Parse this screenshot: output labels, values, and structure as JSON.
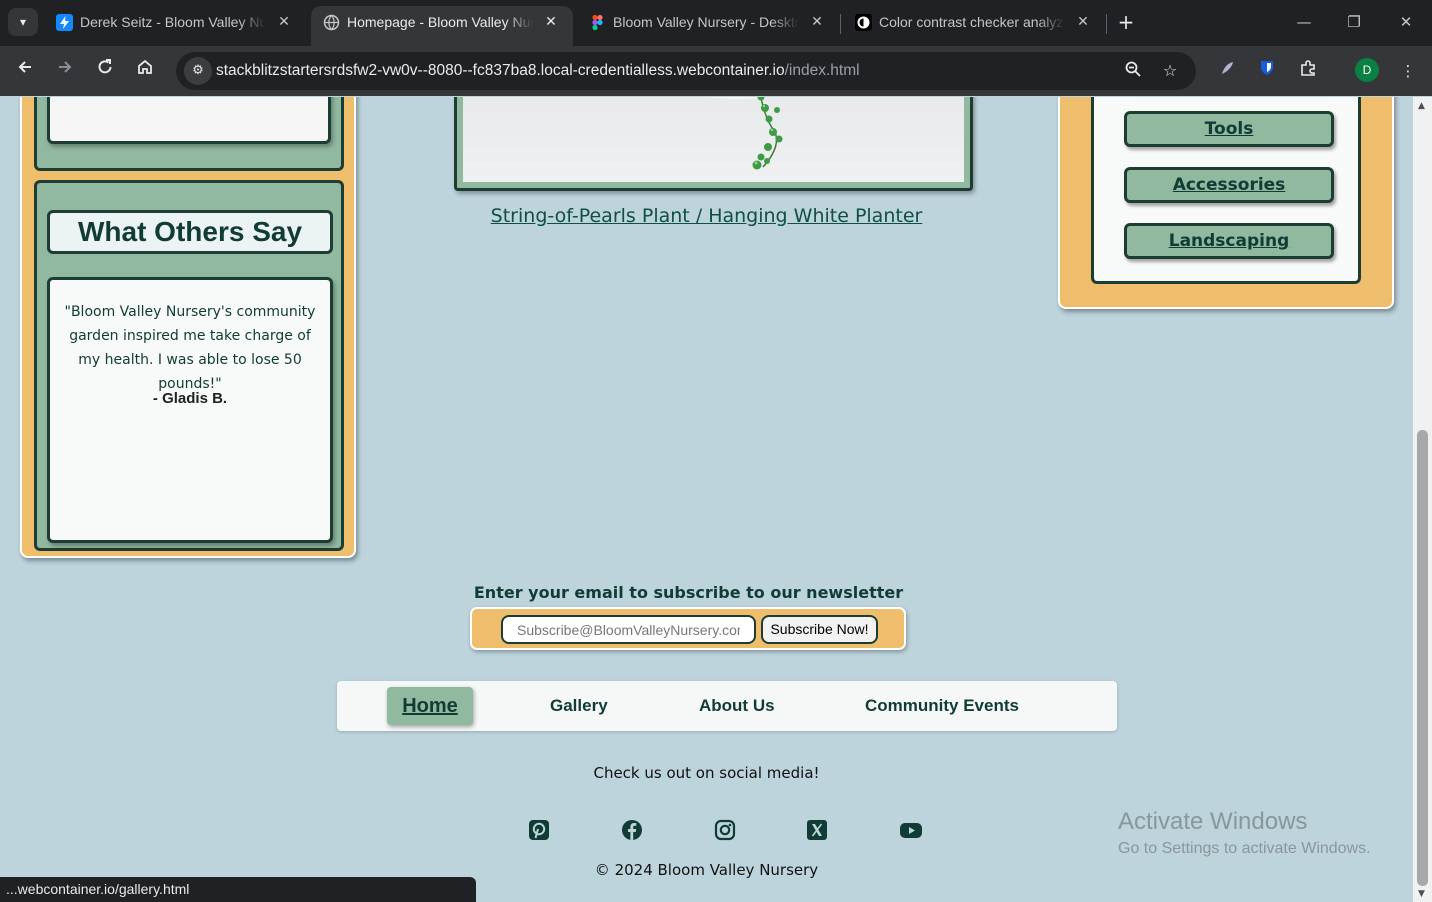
{
  "browser": {
    "tabs": [
      {
        "title": "Derek Seitz - Bloom Valley Nurs",
        "active": false,
        "favicon": "stackblitz-icon"
      },
      {
        "title": "Homepage - Bloom Valley Nurs",
        "active": true,
        "favicon": "globe-icon"
      },
      {
        "title": "Bloom Valley Nursery - Desktop",
        "active": false,
        "favicon": "figma-icon"
      },
      {
        "title": "Color contrast checker analyzer",
        "active": false,
        "favicon": "contrast-icon"
      }
    ],
    "url_main": "stackblitzstartersrdsfw2-vw0v--8080--fc837ba8.local-credentialless.webcontainer.io",
    "url_path": "/index.html",
    "profile_initial": "D",
    "status_url": "...webcontainer.io/gallery.html"
  },
  "testimonial": {
    "heading": "What Others Say",
    "quote": "\"Bloom Valley Nursery's community garden inspired me take charge of my health. I was able to lose 50 pounds!\"",
    "author": "- Gladis B."
  },
  "product": {
    "link": "String-of-Pearls Plant / Hanging White Planter"
  },
  "categories": {
    "items": [
      "Tools",
      "Accessories",
      "Landscaping"
    ]
  },
  "newsletter": {
    "label": "Enter your email to subscribe to our newsletter",
    "placeholder": "Subscribe@BloomValleyNursery.com",
    "button": "Subscribe Now!"
  },
  "footer_nav": {
    "home": "Home",
    "gallery": "Gallery",
    "about": "About Us",
    "events": "Community Events"
  },
  "social": {
    "label": "Check us out on social media!",
    "icons": [
      "pinterest-icon",
      "facebook-icon",
      "instagram-icon",
      "x-icon",
      "youtube-icon"
    ]
  },
  "copyright": "© 2024 Bloom Valley Nursery",
  "watermark": {
    "line1": "Activate Windows",
    "line2": "Go to Settings to activate Windows."
  },
  "colors": {
    "page_bg": "#bdd4dc",
    "accent_gold": "#efbe6c",
    "sage": "#91b9a0",
    "dark_green": "#103c35"
  }
}
